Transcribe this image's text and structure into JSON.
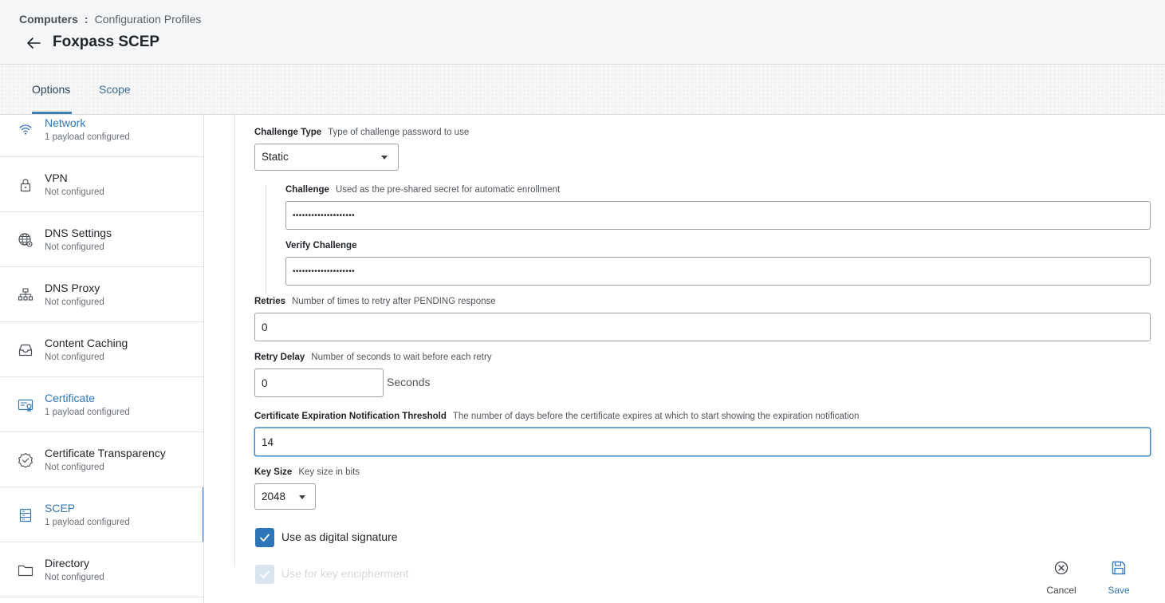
{
  "header": {
    "breadcrumb_root": "Computers",
    "breadcrumb_separator": ":",
    "breadcrumb_current": "Configuration Profiles",
    "title": "Foxpass SCEP"
  },
  "tabs": [
    {
      "label": "Options",
      "active": true
    },
    {
      "label": "Scope",
      "active": false
    }
  ],
  "sidebar": {
    "items": [
      {
        "label": "Network",
        "status": "1 payload configured",
        "icon": "wifi-icon",
        "configured": true
      },
      {
        "label": "VPN",
        "status": "Not configured",
        "icon": "lock-icon",
        "configured": false
      },
      {
        "label": "DNS Settings",
        "status": "Not configured",
        "icon": "globe-gear-icon",
        "configured": false
      },
      {
        "label": "DNS Proxy",
        "status": "Not configured",
        "icon": "network-hierarchy-icon",
        "configured": false
      },
      {
        "label": "Content Caching",
        "status": "Not configured",
        "icon": "inbox-tray-icon",
        "configured": false
      },
      {
        "label": "Certificate",
        "status": "1 payload configured",
        "icon": "certificate-icon",
        "configured": true
      },
      {
        "label": "Certificate Transparency",
        "status": "Not configured",
        "icon": "check-badge-icon",
        "configured": false
      },
      {
        "label": "SCEP",
        "status": "1 payload configured",
        "icon": "server-list-icon",
        "configured": true,
        "selected": true
      },
      {
        "label": "Directory",
        "status": "Not configured",
        "icon": "folder-icon",
        "configured": false
      }
    ]
  },
  "form": {
    "challenge_type": {
      "label": "Challenge Type",
      "help": "Type of challenge password to use",
      "value": "Static"
    },
    "challenge": {
      "label": "Challenge",
      "help": "Used as the pre-shared secret for automatic enrollment",
      "value": "••••••••••••••••••••"
    },
    "verify_challenge": {
      "label": "Verify Challenge",
      "value": "••••••••••••••••••••"
    },
    "retries": {
      "label": "Retries",
      "help": "Number of times to retry after PENDING response",
      "value": "0"
    },
    "retry_delay": {
      "label": "Retry Delay",
      "help": "Number of seconds to wait before each retry",
      "value": "0",
      "suffix": "Seconds"
    },
    "expiration_threshold": {
      "label": "Certificate Expiration Notification Threshold",
      "help": "The number of days before the certificate expires at which to start showing the expiration notification",
      "value": "14"
    },
    "key_size": {
      "label": "Key Size",
      "help": "Key size in bits",
      "value": "2048"
    },
    "digital_signature": {
      "label": "Use as digital signature",
      "checked": true
    },
    "key_encipherment": {
      "label": "Use for key encipherment",
      "checked": true
    }
  },
  "actions": {
    "cancel_label": "Cancel",
    "save_label": "Save"
  },
  "colors": {
    "accent": "#2f76b8",
    "header_bg": "#f5f6f8",
    "border": "#d9dbde"
  }
}
